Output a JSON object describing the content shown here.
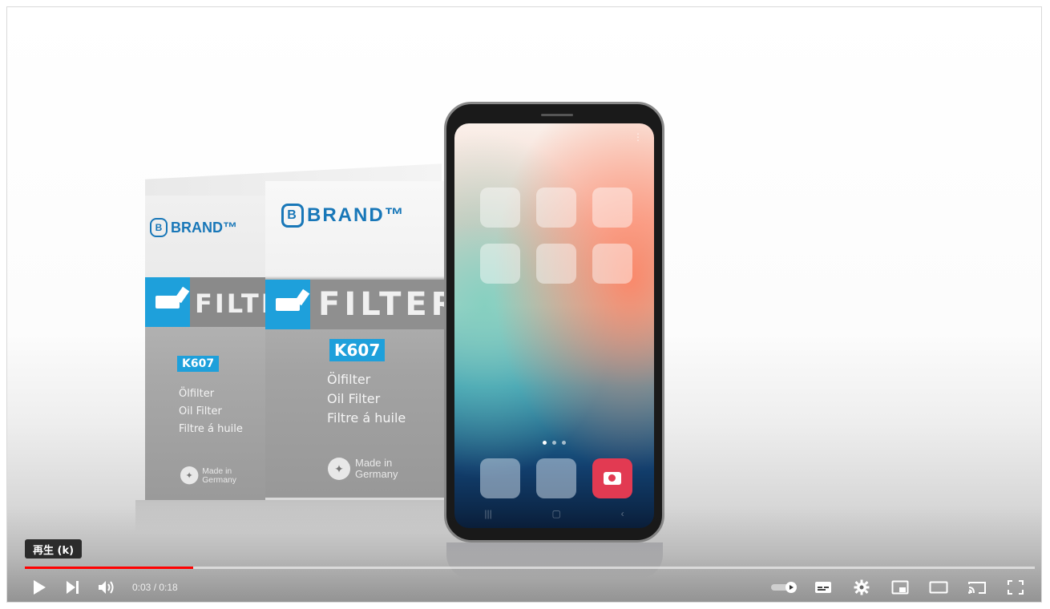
{
  "video": {
    "box": {
      "brand": "BRAND™",
      "brand_logo_letter": "B",
      "band_word": "FILTER",
      "model": "K607",
      "desc_de": "Ölfilter",
      "desc_en": "Oil Filter",
      "desc_fr": "Filtre á huile",
      "made_in": "Made in Germany"
    },
    "phone": {
      "apps_count": 6,
      "dock_apps": [
        "app",
        "app",
        "camera"
      ]
    }
  },
  "player": {
    "tooltip": "再生 (k)",
    "time_current": "0:03",
    "time_total": "0:18",
    "time_display": "0:03 / 0:18",
    "progress_fraction": 0.167,
    "icons": {
      "play": "play-icon",
      "next": "next-icon",
      "volume": "volume-icon",
      "autoplay": "autoplay-toggle-icon",
      "subtitles": "subtitles-icon",
      "settings": "gear-icon",
      "miniplayer": "miniplayer-icon",
      "theater": "theater-mode-icon",
      "cast": "cast-icon",
      "fullscreen": "fullscreen-icon"
    },
    "colors": {
      "progress": "#ff0000",
      "accent_brand": "#1ea0db",
      "camera_app": "#e23a52"
    }
  }
}
